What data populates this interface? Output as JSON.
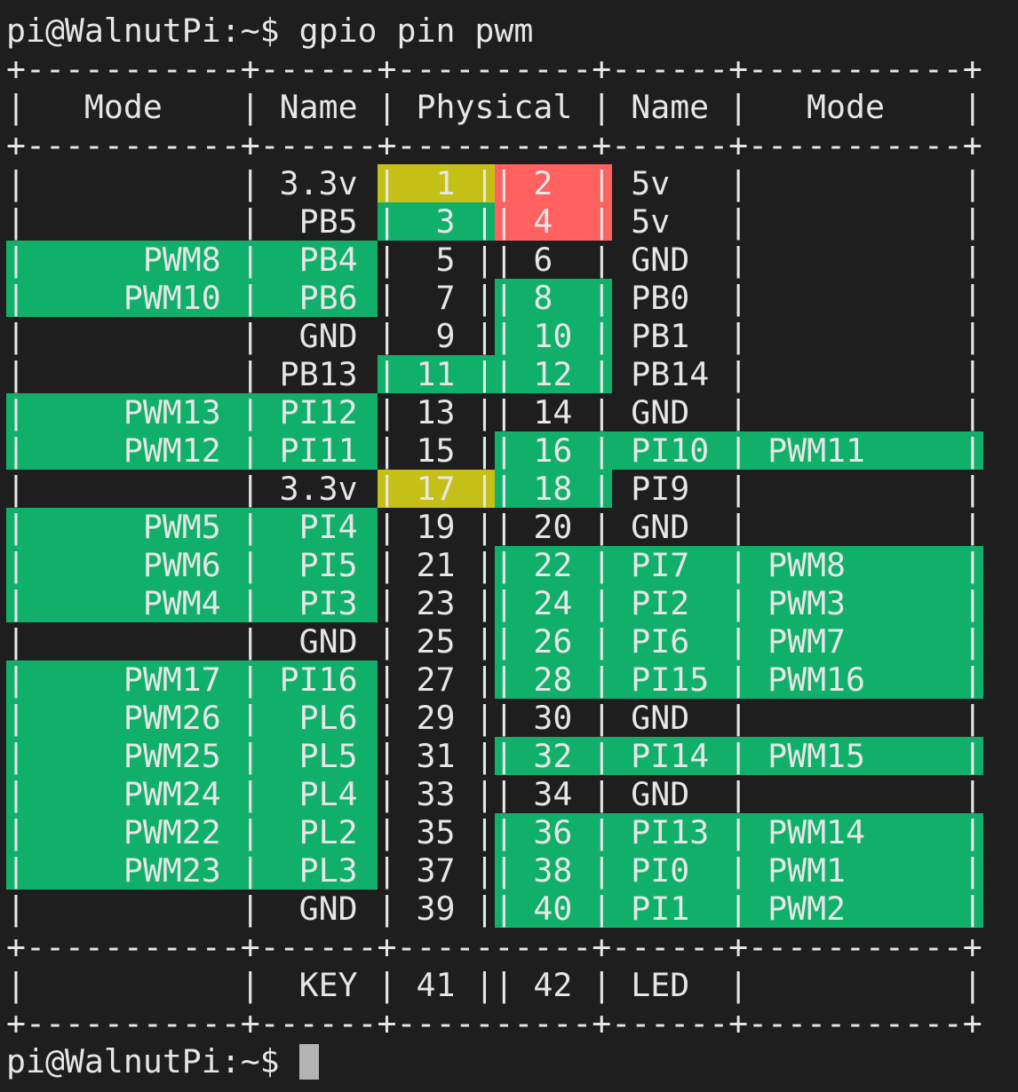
{
  "terminal": {
    "prompt": "pi@WalnutPi:~$ ",
    "command": "gpio pin pwm",
    "final_prompt": "pi@WalnutPi:~$ "
  },
  "colors": {
    "background": "#1e1e1e",
    "text": "#e6e6e6",
    "green": "#10b06a",
    "yellow": "#c4c018",
    "red": "#ff6060",
    "cursor": "#b4b4b4"
  },
  "table": {
    "border_line": "+-----------+------+----------+------+-----------+",
    "headers": {
      "mode_left": "Mode",
      "name_left": "Name",
      "physical": "Physical",
      "name_right": "Name",
      "mode_right": "Mode"
    },
    "rows": [
      {
        "lmode": "",
        "lname": "3.3v",
        "lphys": "1",
        "rphys": "2",
        "rname": "5v",
        "rmode": "",
        "lname_bg": "",
        "lphys_bg": "yellow",
        "rphys_bg": "red",
        "rname_bg": ""
      },
      {
        "lmode": "",
        "lname": "PB5",
        "lphys": "3",
        "rphys": "4",
        "rname": "5v",
        "rmode": "",
        "lname_bg": "",
        "lphys_bg": "green",
        "rphys_bg": "red",
        "rname_bg": ""
      },
      {
        "lmode": "PWM8",
        "lname": "PB4",
        "lphys": "5",
        "rphys": "6",
        "rname": "GND",
        "rmode": "",
        "lname_bg": "green",
        "lphys_bg": "green",
        "rphys_bg": "",
        "rname_bg": ""
      },
      {
        "lmode": "PWM10",
        "lname": "PB6",
        "lphys": "7",
        "rphys": "8",
        "rname": "PB0",
        "rmode": "",
        "lname_bg": "green",
        "lphys_bg": "green",
        "rphys_bg": "green",
        "rname_bg": ""
      },
      {
        "lmode": "",
        "lname": "GND",
        "lphys": "9",
        "rphys": "10",
        "rname": "PB1",
        "rmode": "",
        "lname_bg": "",
        "lphys_bg": "",
        "rphys_bg": "green",
        "rname_bg": ""
      },
      {
        "lmode": "",
        "lname": "PB13",
        "lphys": "11",
        "rphys": "12",
        "rname": "PB14",
        "rmode": "",
        "lname_bg": "",
        "lphys_bg": "green",
        "rphys_bg": "green",
        "rname_bg": ""
      },
      {
        "lmode": "PWM13",
        "lname": "PI12",
        "lphys": "13",
        "rphys": "14",
        "rname": "GND",
        "rmode": "",
        "lname_bg": "green",
        "lphys_bg": "green",
        "rphys_bg": "",
        "rname_bg": ""
      },
      {
        "lmode": "PWM12",
        "lname": "PI11",
        "lphys": "15",
        "rphys": "16",
        "rname": "PI10",
        "rmode": "PWM11",
        "lname_bg": "green",
        "lphys_bg": "green",
        "rphys_bg": "green",
        "rname_bg": "green"
      },
      {
        "lmode": "",
        "lname": "3.3v",
        "lphys": "17",
        "rphys": "18",
        "rname": "PI9",
        "rmode": "",
        "lname_bg": "",
        "lphys_bg": "yellow",
        "rphys_bg": "green",
        "rname_bg": ""
      },
      {
        "lmode": "PWM5",
        "lname": "PI4",
        "lphys": "19",
        "rphys": "20",
        "rname": "GND",
        "rmode": "",
        "lname_bg": "green",
        "lphys_bg": "green",
        "rphys_bg": "",
        "rname_bg": ""
      },
      {
        "lmode": "PWM6",
        "lname": "PI5",
        "lphys": "21",
        "rphys": "22",
        "rname": "PI7",
        "rmode": "PWM8",
        "lname_bg": "green",
        "lphys_bg": "green",
        "rphys_bg": "green",
        "rname_bg": "green"
      },
      {
        "lmode": "PWM4",
        "lname": "PI3",
        "lphys": "23",
        "rphys": "24",
        "rname": "PI2",
        "rmode": "PWM3",
        "lname_bg": "green",
        "lphys_bg": "green",
        "rphys_bg": "green",
        "rname_bg": "green"
      },
      {
        "lmode": "",
        "lname": "GND",
        "lphys": "25",
        "rphys": "26",
        "rname": "PI6",
        "rmode": "PWM7",
        "lname_bg": "",
        "lphys_bg": "",
        "rphys_bg": "green",
        "rname_bg": "green"
      },
      {
        "lmode": "PWM17",
        "lname": "PI16",
        "lphys": "27",
        "rphys": "28",
        "rname": "PI15",
        "rmode": "PWM16",
        "lname_bg": "green",
        "lphys_bg": "green",
        "rphys_bg": "green",
        "rname_bg": "green"
      },
      {
        "lmode": "PWM26",
        "lname": "PL6",
        "lphys": "29",
        "rphys": "30",
        "rname": "GND",
        "rmode": "",
        "lname_bg": "green",
        "lphys_bg": "green",
        "rphys_bg": "",
        "rname_bg": ""
      },
      {
        "lmode": "PWM25",
        "lname": "PL5",
        "lphys": "31",
        "rphys": "32",
        "rname": "PI14",
        "rmode": "PWM15",
        "lname_bg": "green",
        "lphys_bg": "green",
        "rphys_bg": "green",
        "rname_bg": "green"
      },
      {
        "lmode": "PWM24",
        "lname": "PL4",
        "lphys": "33",
        "rphys": "34",
        "rname": "GND",
        "rmode": "",
        "lname_bg": "green",
        "lphys_bg": "green",
        "rphys_bg": "",
        "rname_bg": ""
      },
      {
        "lmode": "PWM22",
        "lname": "PL2",
        "lphys": "35",
        "rphys": "36",
        "rname": "PI13",
        "rmode": "PWM14",
        "lname_bg": "green",
        "lphys_bg": "green",
        "rphys_bg": "green",
        "rname_bg": "green"
      },
      {
        "lmode": "PWM23",
        "lname": "PL3",
        "lphys": "37",
        "rphys": "38",
        "rname": "PI0",
        "rmode": "PWM1",
        "lname_bg": "green",
        "lphys_bg": "green",
        "rphys_bg": "green",
        "rname_bg": "green"
      },
      {
        "lmode": "",
        "lname": "GND",
        "lphys": "39",
        "rphys": "40",
        "rname": "PI1",
        "rmode": "PWM2",
        "lname_bg": "",
        "lphys_bg": "",
        "rphys_bg": "green",
        "rname_bg": "green"
      }
    ],
    "extra_row": {
      "lmode": "",
      "lname": "KEY",
      "lphys": "41",
      "rphys": "42",
      "rname": "LED",
      "rmode": ""
    }
  }
}
